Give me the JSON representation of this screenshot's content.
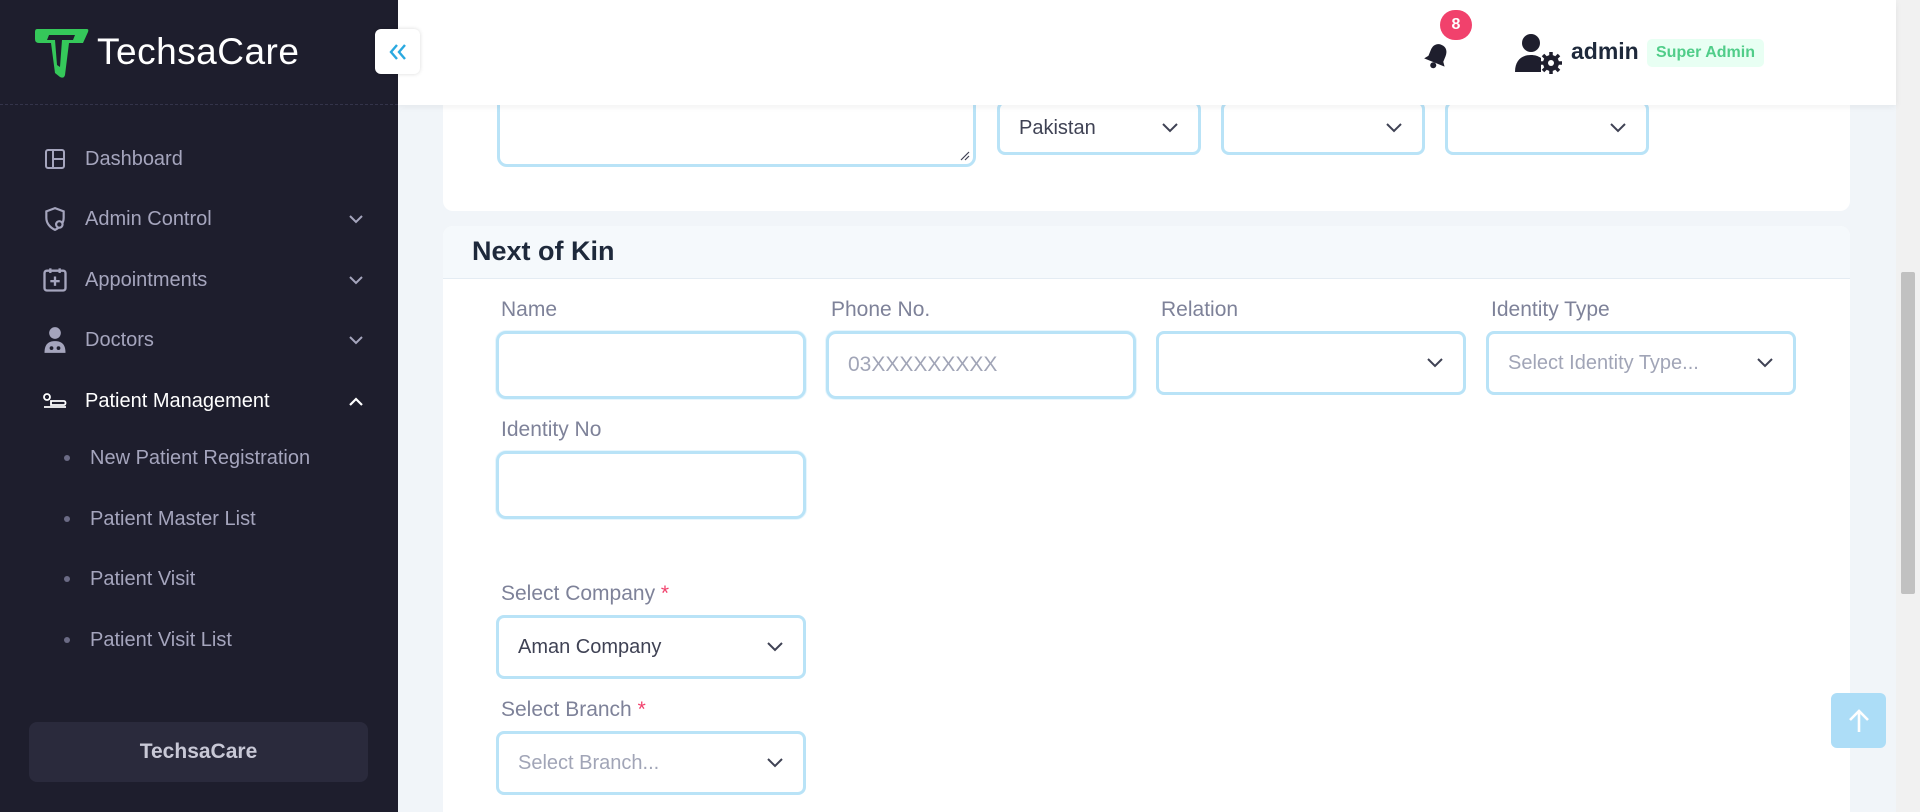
{
  "brand": {
    "name": "TechsaCare",
    "accent": "#2aa9e0",
    "logo_color": "#35c85a"
  },
  "sidebar": {
    "items": [
      {
        "label": "Dashboard",
        "icon": "dashboard-icon"
      },
      {
        "label": "Admin Control",
        "icon": "shield-icon",
        "expandable": true
      },
      {
        "label": "Appointments",
        "icon": "calendar-plus-icon",
        "expandable": true
      },
      {
        "label": "Doctors",
        "icon": "doctor-icon",
        "expandable": true
      },
      {
        "label": "Patient Management",
        "icon": "patient-icon",
        "expandable": true,
        "expanded": true
      }
    ],
    "subitems": [
      {
        "label": "New Patient Registration"
      },
      {
        "label": "Patient Master List"
      },
      {
        "label": "Patient Visit"
      },
      {
        "label": "Patient Visit List"
      }
    ],
    "footer": "TechsaCare"
  },
  "header": {
    "notification_count": "8",
    "user_name": "admin",
    "user_role": "Super Admin"
  },
  "address_row": {
    "country": "Pakistan",
    "province": "",
    "city": ""
  },
  "next_of_kin": {
    "title": "Next of Kin",
    "name_label": "Name",
    "name_value": "",
    "phone_label": "Phone No.",
    "phone_placeholder": "03XXXXXXXXX",
    "relation_label": "Relation",
    "relation_value": "",
    "identity_type_label": "Identity Type",
    "identity_type_placeholder": "Select Identity Type...",
    "identity_no_label": "Identity No",
    "identity_no_value": ""
  },
  "company": {
    "label": "Select Company",
    "required_mark": "*",
    "value": "Aman Company"
  },
  "branch": {
    "label": "Select Branch",
    "required_mark": "*",
    "placeholder": "Select Branch..."
  }
}
